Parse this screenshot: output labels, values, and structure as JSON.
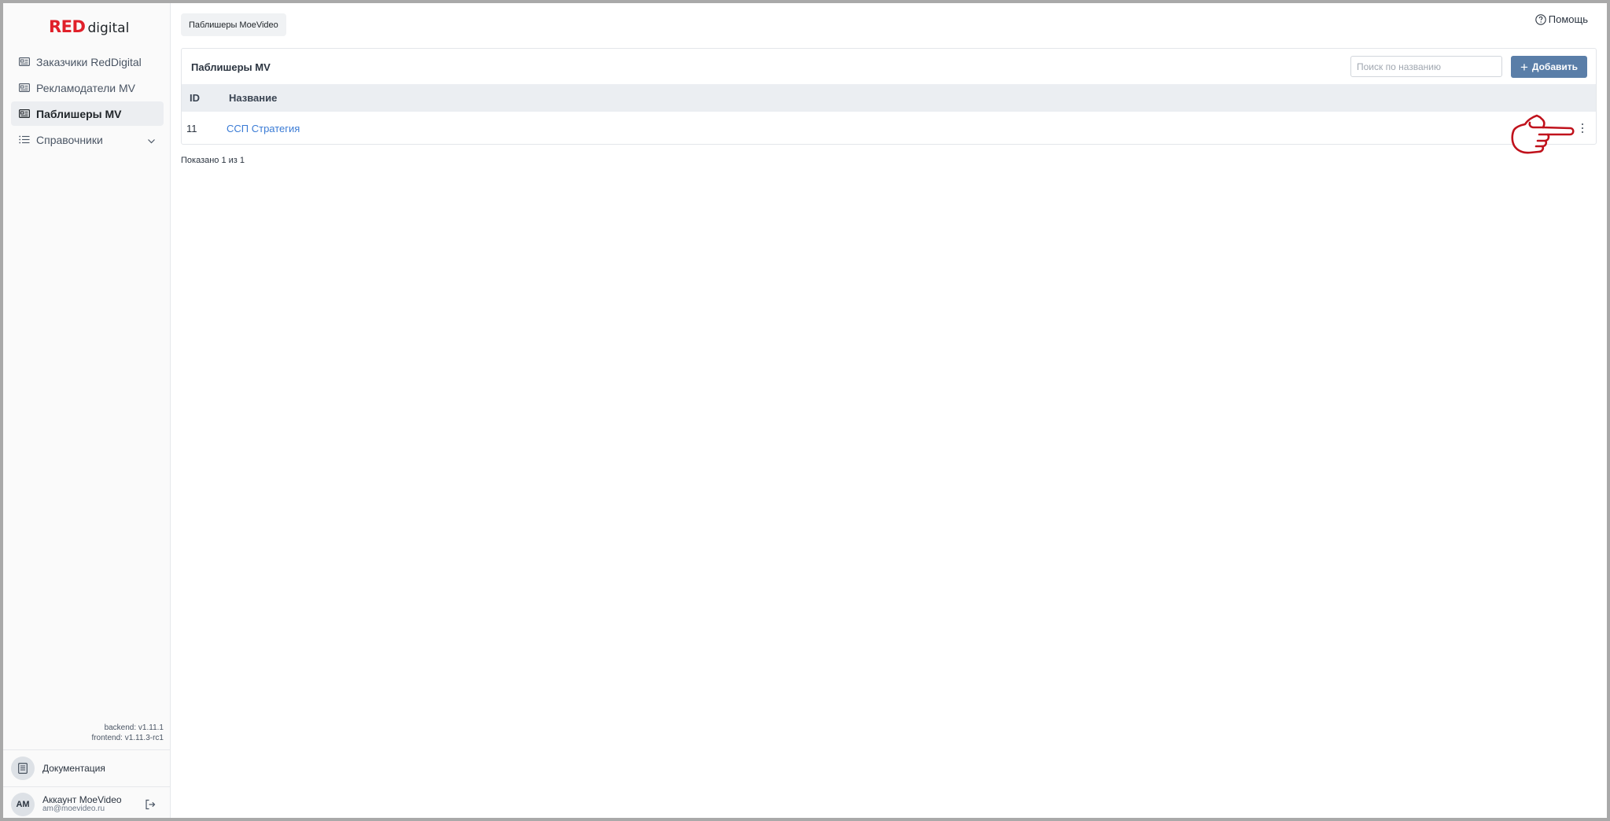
{
  "app": {
    "logo_red": "RED",
    "logo_rest": "digital"
  },
  "sidebar": {
    "items": [
      {
        "label": "Заказчики RedDigital",
        "icon": "id-card-icon",
        "active": false
      },
      {
        "label": "Рекламодатели MV",
        "icon": "id-card-icon",
        "active": false
      },
      {
        "label": "Паблишеры MV",
        "icon": "id-card-icon",
        "active": true
      },
      {
        "label": "Справочники",
        "icon": "list-icon",
        "active": false,
        "expandable": true
      }
    ],
    "versions": {
      "backend": "backend: v1.11.1",
      "frontend": "frontend: v1.11.3-rc1"
    },
    "docs_label": "Документация",
    "account": {
      "initials": "AM",
      "name": "Аккаунт MoeVideo",
      "email": "am@moevideo.ru"
    }
  },
  "header": {
    "breadcrumb": "Паблишеры MoeVideo",
    "help_label": "Помощь"
  },
  "main": {
    "card_title": "Паблишеры MV",
    "search_placeholder": "Поиск по названию",
    "search_value": "",
    "add_label": "Добавить",
    "columns": [
      "ID",
      "Название"
    ],
    "rows": [
      {
        "id": "11",
        "name": "ССП Стратегия"
      }
    ],
    "shown_text": "Показано 1 из 1"
  },
  "colors": {
    "brand_red": "#e0202a",
    "primary_button": "#5a7ea8",
    "link": "#3a7bd5",
    "pointer_annotation": "#c0121c"
  }
}
